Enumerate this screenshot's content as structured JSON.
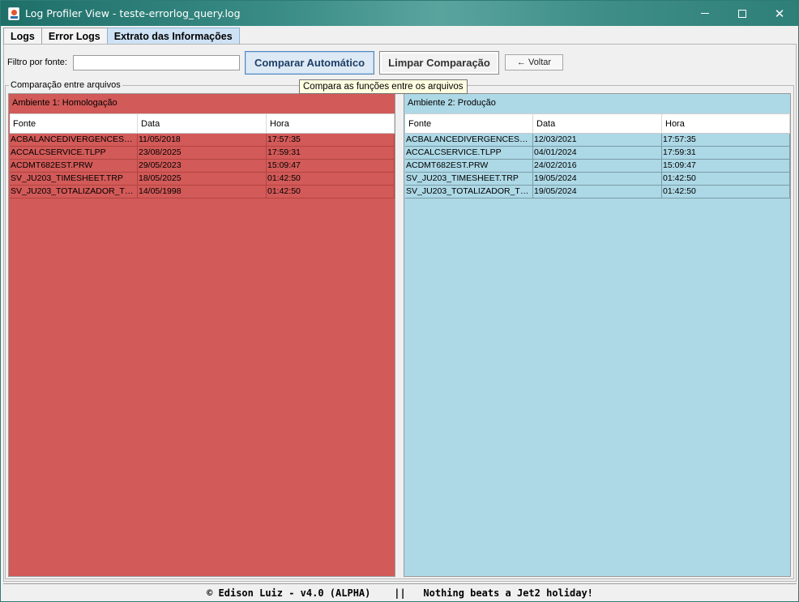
{
  "window": {
    "title": "Log Profiler View - teste-errorlog_query.log",
    "title_bg_color": "#2f7f79"
  },
  "tabs": [
    {
      "label": "Logs",
      "active": false
    },
    {
      "label": "Error Logs",
      "active": false
    },
    {
      "label": "Extrato das Informações",
      "active": true
    }
  ],
  "toolbar": {
    "filter_label": "Filtro por fonte:",
    "filter_value": "",
    "compare_label": "Comparar Automático",
    "clear_label": "Limpar Comparação",
    "back_label": "← Voltar",
    "tooltip": "Compara as funções entre os arquivos"
  },
  "group_title": "Comparação entre arquivos",
  "columns": [
    "Fonte",
    "Data",
    "Hora"
  ],
  "env1": {
    "title": "Ambiente 1: Homologação",
    "bg_color": "#d25a58",
    "rows": [
      [
        "ACBALANCEDIVERGENCESER...",
        "11/05/2018",
        "17:57:35"
      ],
      [
        "ACCALCSERVICE.TLPP",
        "23/08/2025",
        "17:59:31"
      ],
      [
        "ACDMT682EST.PRW",
        "29/05/2023",
        "15:09:47"
      ],
      [
        "SV_JU203_TIMESHEET.TRP",
        "18/05/2025",
        "01:42:50"
      ],
      [
        "SV_JU203_TOTALIZADOR_TE...",
        "14/05/1998",
        "01:42:50"
      ]
    ]
  },
  "env2": {
    "title": "Ambiente 2: Produção",
    "bg_color": "#add8e6",
    "rows": [
      [
        "ACBALANCEDIVERGENCESER...",
        "12/03/2021",
        "17:57:35"
      ],
      [
        "ACCALCSERVICE.TLPP",
        "04/01/2024",
        "17:59:31"
      ],
      [
        "ACDMT682EST.PRW",
        "24/02/2016",
        "15:09:47"
      ],
      [
        "SV_JU203_TIMESHEET.TRP",
        "19/05/2024",
        "01:42:50"
      ],
      [
        "SV_JU203_TOTALIZADOR_TE...",
        "19/05/2024",
        "01:42:50"
      ]
    ]
  },
  "footer": "© Edison Luiz - v4.0 (ALPHA)    ||   Nothing beats a Jet2 holiday!"
}
